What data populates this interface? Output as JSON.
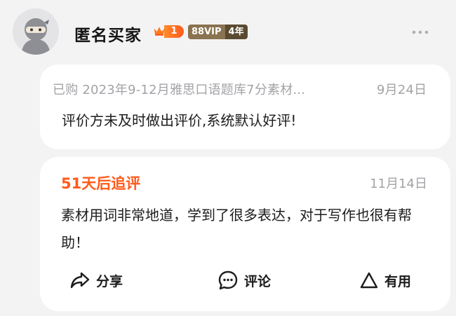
{
  "header": {
    "username": "匿名买家",
    "level": "1",
    "vip_label": "88VIP",
    "vip_years": "4年"
  },
  "review": {
    "purchase_label": "已购",
    "product": "2023年9-12月雅思口语题库7分素材...",
    "date": "9月24日",
    "text": "评价方未及时做出评价,系统默认好评!"
  },
  "followup": {
    "title": "51天后追评",
    "date": "11月14日",
    "text": "素材用词非常地道，学到了很多表达，对于写作也很有帮助！"
  },
  "actions": {
    "share": "分享",
    "comment": "评论",
    "useful": "有用"
  },
  "colors": {
    "accent": "#ff5a1a",
    "vip": "#8a7350",
    "background": "#f3f3f4"
  }
}
